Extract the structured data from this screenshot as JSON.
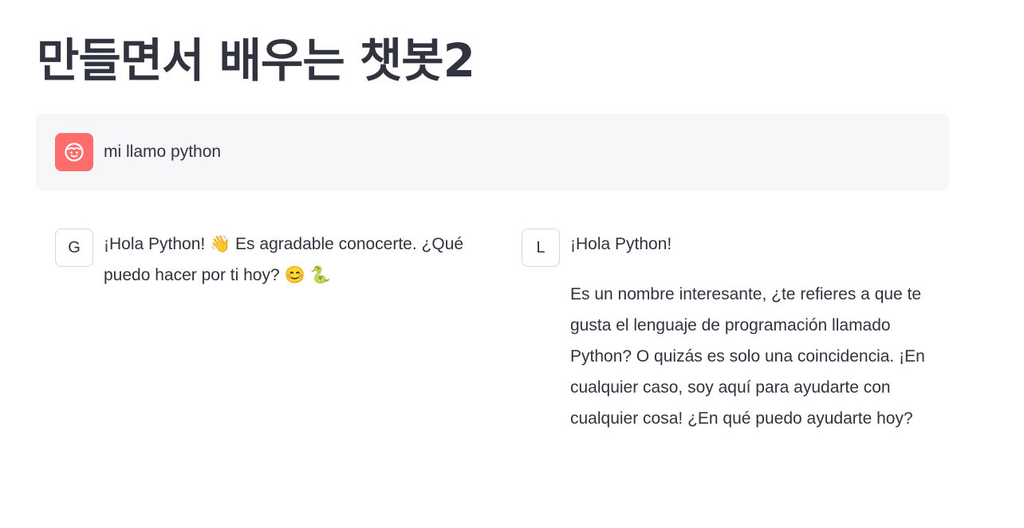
{
  "page": {
    "title": "만들면서 배우는 챗봇2"
  },
  "user_message": {
    "avatar_icon": "smiling-face-icon",
    "avatar_color": "#ff6c6c",
    "text": "mi llamo python"
  },
  "responses": [
    {
      "avatar_label": "G",
      "paragraphs": [
        "¡Hola Python! 👋 Es agradable conocerte. ¿Qué puedo hacer por ti hoy? 😊 🐍"
      ]
    },
    {
      "avatar_label": "L",
      "paragraphs": [
        "¡Hola Python!",
        "Es un nombre interesante, ¿te refieres a que te gusta el lenguaje de programación llamado Python? O quizás es solo una coincidencia. ¡En cualquier caso, soy aquí para ayudarte con cualquier cosa! ¿En qué puedo ayudarte hoy?"
      ]
    }
  ]
}
